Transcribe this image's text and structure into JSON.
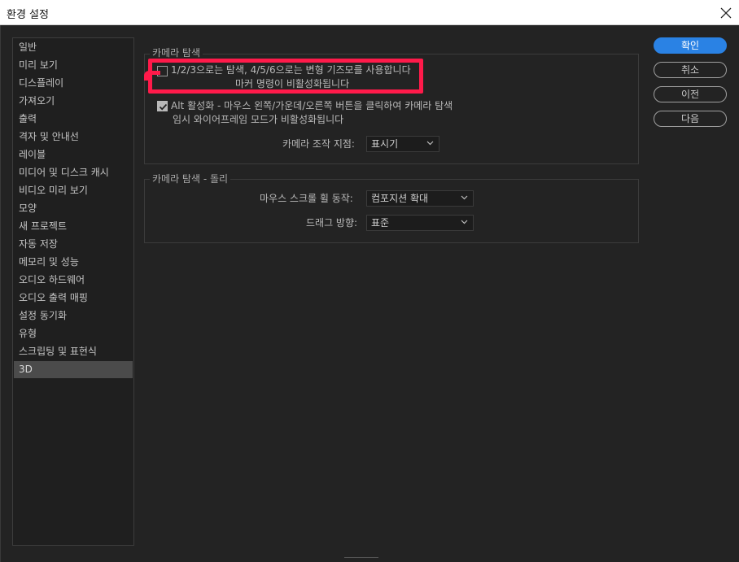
{
  "window": {
    "title": "환경 설정"
  },
  "sidebar": {
    "items": [
      "일반",
      "미리 보기",
      "디스플레이",
      "가져오기",
      "출력",
      "격자 및 안내선",
      "레이블",
      "미디어 및 디스크 캐시",
      "비디오 미리 보기",
      "모양",
      "새 프로젝트",
      "자동 저장",
      "메모리 및 성능",
      "오디오 하드웨어",
      "오디오 출력 매핑",
      "설정 동기화",
      "유형",
      "스크립팅 및 표현식",
      "3D"
    ],
    "active_index": 18
  },
  "camera_nav": {
    "title": "카메라 탐색",
    "option1_line1": "1/2/3으로는 탐색, 4/5/6으로는 변형 기즈모를 사용합니다",
    "option1_line2": "마커 명령이 비활성화됩니다",
    "option1_checked": false,
    "option2_line1": "Alt 활성화 - 마우스 왼쪽/가운데/오른쪽 버튼을 클릭하여 카메라 탐색",
    "option2_line2": "임시 와이어프레임 모드가 비활성화됩니다",
    "option2_checked": true,
    "pivot_label": "카메라 조작 지점:",
    "pivot_value": "표시기"
  },
  "camera_dolly": {
    "title": "카메라 탐색 - 돌리",
    "scroll_label": "마우스 스크롤 휠 동작:",
    "scroll_value": "컴포지션 확대",
    "drag_label": "드래그 방향:",
    "drag_value": "표준"
  },
  "buttons": {
    "ok": "확인",
    "cancel": "취소",
    "prev": "이전",
    "next": "다음"
  },
  "colors": {
    "accent": "#2a82e4",
    "highlight": "#ff1a4a"
  }
}
